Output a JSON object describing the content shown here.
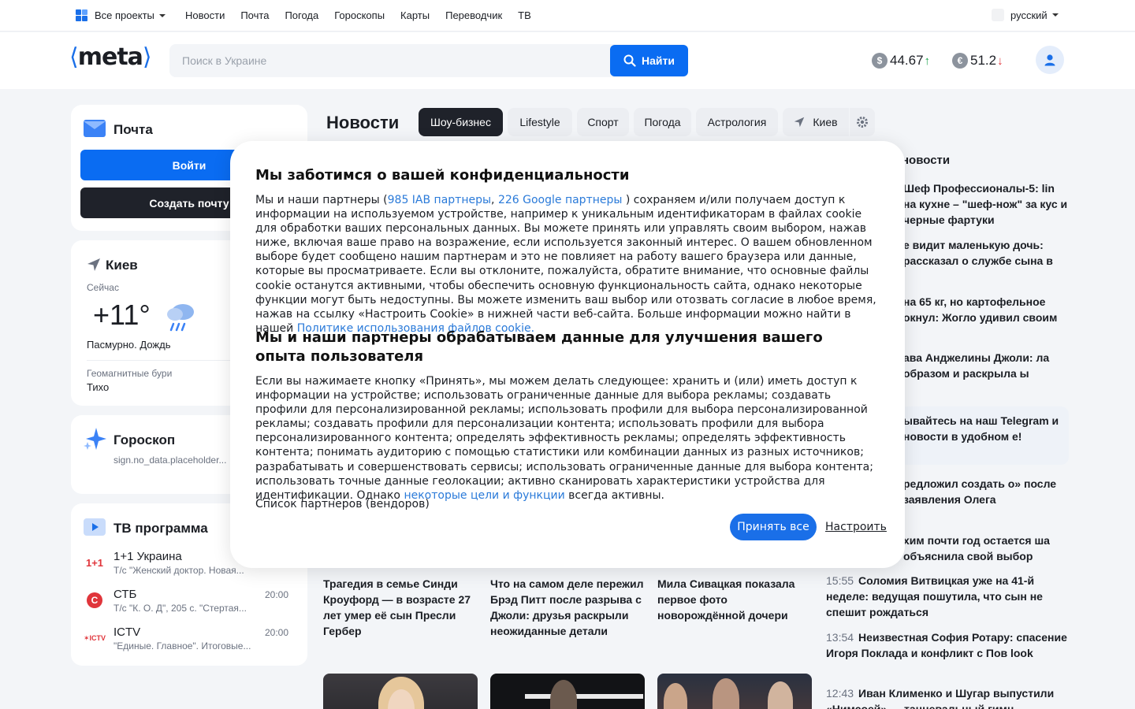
{
  "topnav": {
    "projects": "Все проекты",
    "links": [
      "Новости",
      "Почта",
      "Погода",
      "Гороскопы",
      "Карты",
      "Переводчик",
      "ТВ"
    ],
    "language": "русский"
  },
  "header": {
    "logo_text": "meta",
    "search_placeholder": "Поиск в Украине",
    "search_button": "Найти",
    "usd_symbol": "$",
    "usd_rate": "44.67",
    "usd_trend": "↑",
    "eur_symbol": "€",
    "eur_rate": "51.2",
    "eur_trend": "↓"
  },
  "mail": {
    "title": "Почта",
    "login": "Войти",
    "create": "Создать почту"
  },
  "weather": {
    "city": "Киев",
    "now_label": "Сейчас",
    "temp": "+11°",
    "condition": "Пасмурно. Дождь",
    "geo_label": "Геомагнитные бури",
    "geo_value": "Тихо"
  },
  "horoscope": {
    "title": "Гороскоп",
    "text": "sign.no_data.placeholder..."
  },
  "tv": {
    "title": "ТВ программа",
    "channels": [
      {
        "logo": "1+1",
        "name": "1+1 Украина",
        "time": "",
        "show": "Т/с \"Женский доктор. Новая..."
      },
      {
        "logo": "С",
        "name": "СТБ",
        "time": "20:00",
        "show": "Т/с \"К. О. Д\", 205 с. \"Стертая..."
      },
      {
        "logo": "ICTV",
        "name": "ICTV",
        "time": "20:00",
        "show": "\"Единые. Главное\". Итоговые..."
      }
    ]
  },
  "news": {
    "title": "Новости",
    "tabs": [
      "Шоу-бизнес",
      "Lifestyle",
      "Спорт",
      "Погода",
      "Астрология",
      "Киев"
    ],
    "right_heading": "новости",
    "right_items": [
      {
        "time": "",
        "text": "Шеф Профессионалы-5: lin на кухне – \"шеф-нож\" за кус и черные фартуки"
      },
      {
        "time": "",
        "text": "е видит маленькую дочь: рассказал о службе сына в"
      },
      {
        "time": "",
        "text": "на 65 кг, но картофельное окнул: Жогло удивил своим"
      },
      {
        "time": "",
        "text": "ава Анджелины Джоли: ла образом и раскрыла ы"
      },
      {
        "time": "",
        "text": "ывайтесь на наш Telegram и новости в удобном е!"
      },
      {
        "time": "",
        "text": "редложил создать о» после заявления Олега"
      },
      {
        "time": "",
        "text": "хим почти год остается ша объяснила свой выбор"
      },
      {
        "time": "15:55",
        "text": "Соломия Витвицкая уже на 41-й неделе: ведущая пошутила, что сын не спешит рождаться"
      },
      {
        "time": "13:54",
        "text": "Неизвестная София Ротару: спасение Игоря Поклада и конфликт с Пов look"
      },
      {
        "time": "12:43",
        "text": "Иван Клименко и Шугар выпустили «Нимсоей» — танцевальный гимн"
      }
    ],
    "articles": [
      "Трагедия в семье Синди Кроуфорд — в возрасте 27 лет умер её сын Пресли Гербер",
      "Что на самом деле пережил Брэд Питт после разрыва с Джоли: друзья раскрыли неожиданные детали",
      "Мила Сивацкая показала первое фото новорождённой дочери"
    ]
  },
  "consent": {
    "title1": "Мы заботимся о вашей конфиденциальности",
    "p1_a": "Мы и наши партнеры (",
    "p1_link1": "985 IAB партнеры",
    "p1_comma": ", ",
    "p1_link2": "226 Google партнеры",
    "p1_b": " ) сохраняем и/или получаем доступ к информации на используемом устройстве, например к уникальным идентификаторам в файлах cookie для обработки ваших персональных данных. Вы можете принять или управлять своим выбором, нажав ниже, включая ваше право на возражение, если используется законный интерес. О вашем обновленном выборе будет сообщено нашим партнерам и это не повлияет на работу вашего браузера или данные, которые вы просматриваете. Если вы отклоните, пожалуйста, обратите внимание, что основные файлы cookie останутся активными, чтобы обеспечить основную функциональность сайта, однако некоторые функции могут быть недоступны. Вы можете изменить ваш выбор или отозвать согласие в любое время, нажав на ссылку «Настроить Cookie» в нижней части веб-сайта. Больше информации можно найти в нашей ",
    "p1_link3": "Политике использования файлов cookie.",
    "title2": "Мы и наши партнеры обрабатываем данные для улучшения вашего опыта пользователя",
    "p2_a": "Если вы нажимаете кнопку «Принять», мы можем делать следующее: хранить и (или) иметь доступ к информации на устройстве; использовать ограниченные данные для выбора рекламы; создавать профили для персонализированной рекламы; использовать профили для выбора персонализированной рекламы; создавать профили для персонализации контента; использовать профили для выбора персонализированного контента; определять эффективность рекламы; определять эффективность контента; понимать аудиторию с помощью статистики или комбинации данных из разных источников; разрабатывать и совершенствовать сервисы; использовать ограниченные данные для выбора контента; использовать точные данные геолокации; активно сканировать характеристики устройства для идентификации. Однако ",
    "p2_link": "некоторые цели и функции",
    "p2_b": " всегда активны.",
    "vendors": "Список партнеров (вендоров)",
    "accept": "Принять все",
    "configure": "Настроить"
  }
}
